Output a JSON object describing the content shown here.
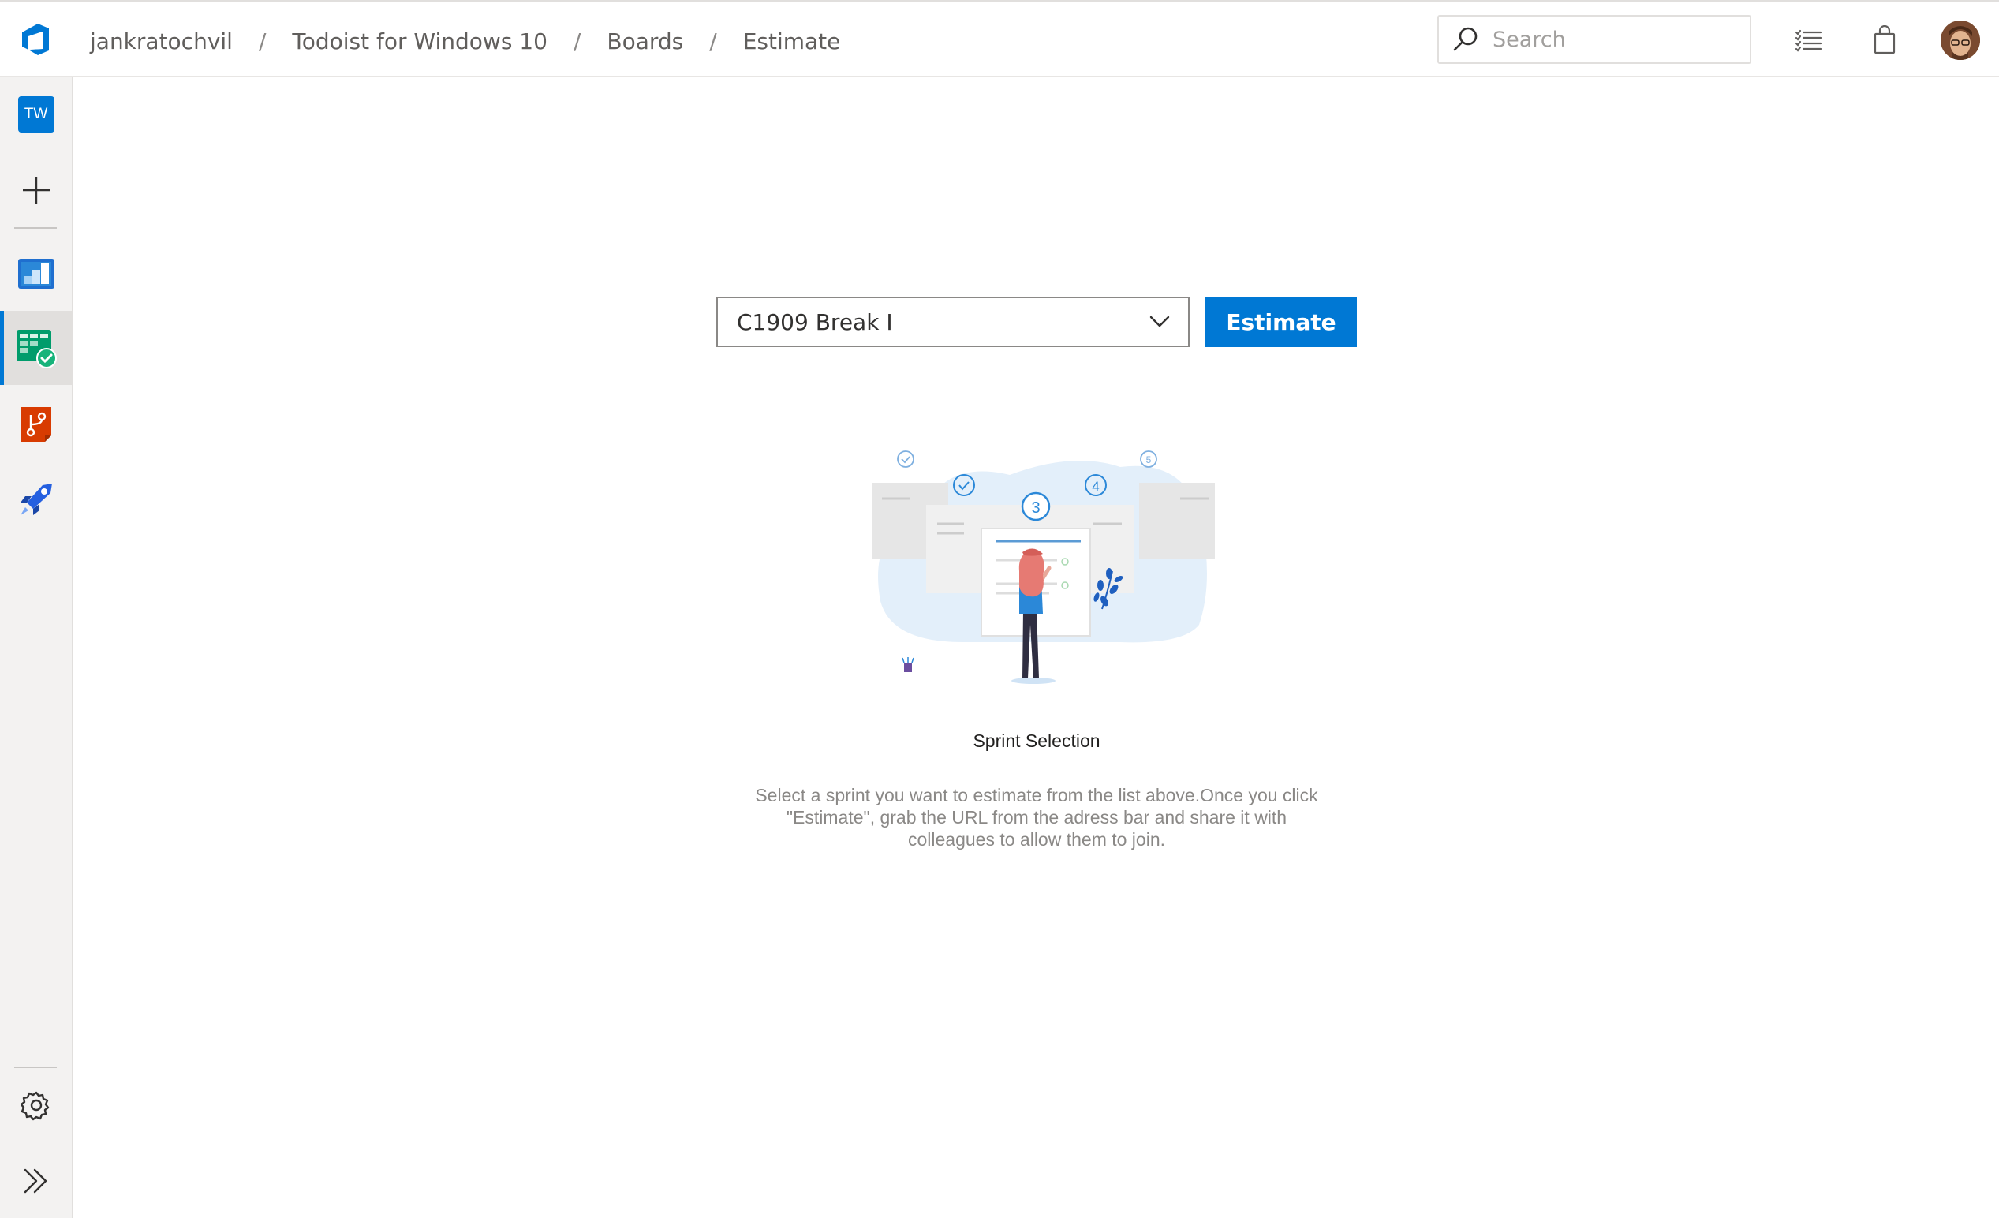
{
  "header": {
    "breadcrumb": [
      {
        "label": "jankratochvil"
      },
      {
        "label": "Todoist for Windows 10"
      },
      {
        "label": "Boards"
      },
      {
        "label": "Estimate"
      }
    ],
    "separator": "/",
    "search_placeholder": "Search",
    "icons": [
      "azure-devops-logo-icon",
      "search-icon",
      "task-list-icon",
      "shopping-bag-icon",
      "user-avatar"
    ]
  },
  "sidebar": {
    "project_badge": "TW",
    "items": [
      {
        "name": "project",
        "icon": "project-badge"
      },
      {
        "name": "new",
        "icon": "plus-icon"
      },
      {
        "name": "overview",
        "icon": "overview-icon"
      },
      {
        "name": "boards",
        "icon": "boards-icon",
        "active": true
      },
      {
        "name": "repos",
        "icon": "repos-icon"
      },
      {
        "name": "pipelines",
        "icon": "pipelines-icon"
      },
      {
        "name": "settings",
        "icon": "gear-icon"
      },
      {
        "name": "expand",
        "icon": "double-chevron-right-icon"
      }
    ]
  },
  "main": {
    "sprint_select": {
      "value": "C1909 Break I"
    },
    "estimate_button": "Estimate",
    "empty_state": {
      "title": "Sprint Selection",
      "description": "Select a sprint you want to estimate from the list above.Once you click \"Estimate\", grab the URL from the adress bar and share it with colleagues to allow them to join.",
      "step_numbers": [
        "3",
        "4",
        "5"
      ]
    }
  },
  "colors": {
    "accent": "#0078d4",
    "rail_bg": "#f3f2f1",
    "active_item": "#e1dfdd",
    "muted_text": "#8a8886"
  }
}
